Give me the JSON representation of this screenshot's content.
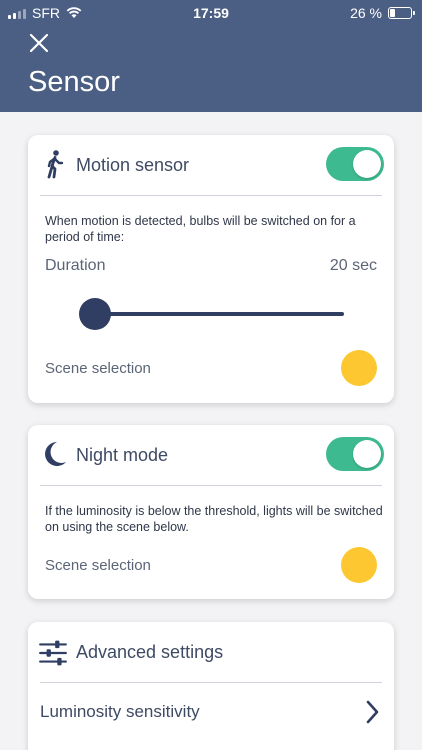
{
  "status_bar": {
    "carrier": "SFR",
    "time": "17:59",
    "battery": "26 %"
  },
  "header": {
    "title": "Sensor"
  },
  "motion": {
    "title": "Motion sensor",
    "enabled": true,
    "description": "When motion is detected, bulbs will be switched on for a period of time:",
    "duration_label": "Duration",
    "duration_value": "20 sec",
    "duration_fraction": 0.0,
    "scene_label": "Scene selection",
    "scene_color": "#fdc731"
  },
  "night": {
    "title": "Night mode",
    "enabled": true,
    "description": "If the luminosity is below the threshold, lights will be switched on using the scene below.",
    "scene_label": "Scene selection",
    "scene_color": "#fdc731"
  },
  "advanced": {
    "title": "Advanced settings",
    "items": [
      {
        "label": "Luminosity sensitivity"
      }
    ]
  },
  "colors": {
    "header": "#4b5e83",
    "toggle_on": "#3dba90",
    "slider": "#2f3e62",
    "scene": "#fdc731"
  }
}
